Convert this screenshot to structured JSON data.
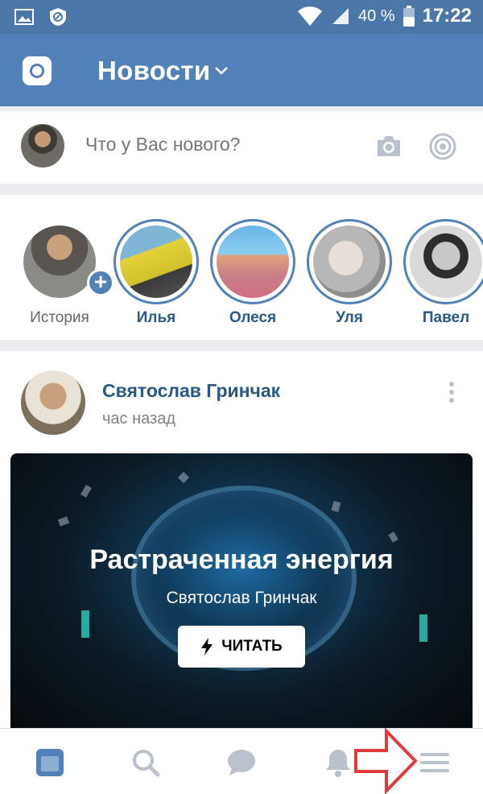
{
  "statusbar": {
    "battery": "40 %",
    "time": "17:22"
  },
  "header": {
    "title": "Новости"
  },
  "composer": {
    "placeholder": "Что у Вас нового?"
  },
  "stories": [
    {
      "name": "История"
    },
    {
      "name": "Илья"
    },
    {
      "name": "Олеся"
    },
    {
      "name": "Уля"
    },
    {
      "name": "Павел"
    }
  ],
  "post": {
    "author": "Святослав Гринчак",
    "time": "час назад",
    "article": {
      "title": "Растраченная энергия",
      "author": "Святослав Гринчак",
      "button": "ЧИТАТЬ"
    }
  },
  "colors": {
    "header": "#5181b8",
    "link": "#2a5885",
    "accent_arrow": "#e03a3a"
  },
  "icons": {
    "statusbar": [
      "gallery-icon",
      "blocked-icon",
      "wifi-icon",
      "signal-icon",
      "battery-icon"
    ],
    "bottomnav": [
      "news-icon",
      "search-icon",
      "messages-icon",
      "notifications-icon",
      "menu-icon"
    ]
  }
}
